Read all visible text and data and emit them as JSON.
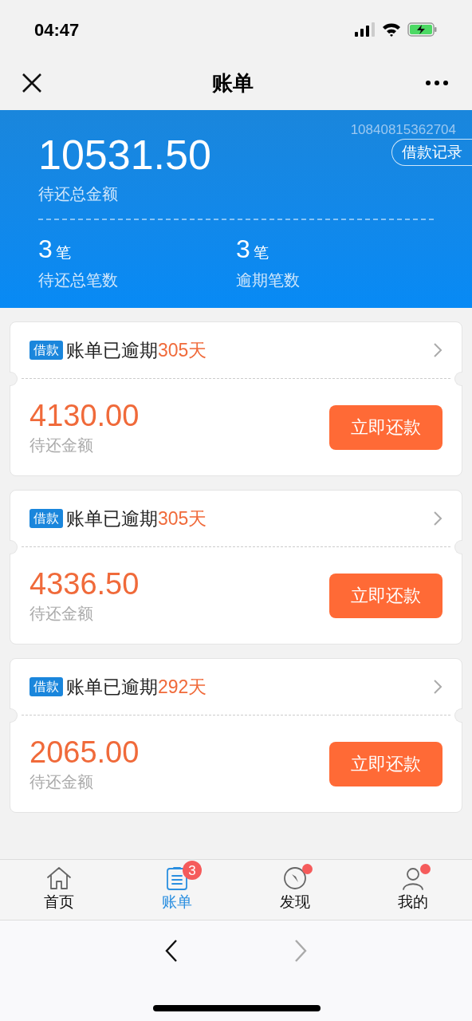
{
  "status_bar": {
    "time": "04:47"
  },
  "nav": {
    "title": "账单"
  },
  "summary": {
    "account": "10840815362704",
    "link": "借款记录",
    "total": "10531.50",
    "total_label": "待还总金额",
    "stats": [
      {
        "value": "3",
        "unit": "笔",
        "label": "待还总笔数"
      },
      {
        "value": "3",
        "unit": "笔",
        "label": "逾期笔数"
      }
    ]
  },
  "bills": [
    {
      "tag": "借款",
      "status": "账单已逾期",
      "overdue": "305天",
      "amount": "4130.00",
      "amount_label": "待还金额",
      "button": "立即还款"
    },
    {
      "tag": "借款",
      "status": "账单已逾期",
      "overdue": "305天",
      "amount": "4336.50",
      "amount_label": "待还金额",
      "button": "立即还款"
    },
    {
      "tag": "借款",
      "status": "账单已逾期",
      "overdue": "292天",
      "amount": "2065.00",
      "amount_label": "待还金额",
      "button": "立即还款"
    }
  ],
  "tabs": [
    {
      "kind": "home",
      "label": "首页",
      "selected": false,
      "dot": false
    },
    {
      "kind": "bill",
      "label": "账单",
      "selected": true,
      "badge": "3",
      "dot": false
    },
    {
      "kind": "discover",
      "label": "发现",
      "selected": false,
      "dot": true
    },
    {
      "kind": "me",
      "label": "我的",
      "selected": false,
      "dot": true
    }
  ],
  "browser": [
    {
      "kind": "back",
      "disabled": false
    },
    {
      "kind": "forward",
      "disabled": true
    }
  ]
}
